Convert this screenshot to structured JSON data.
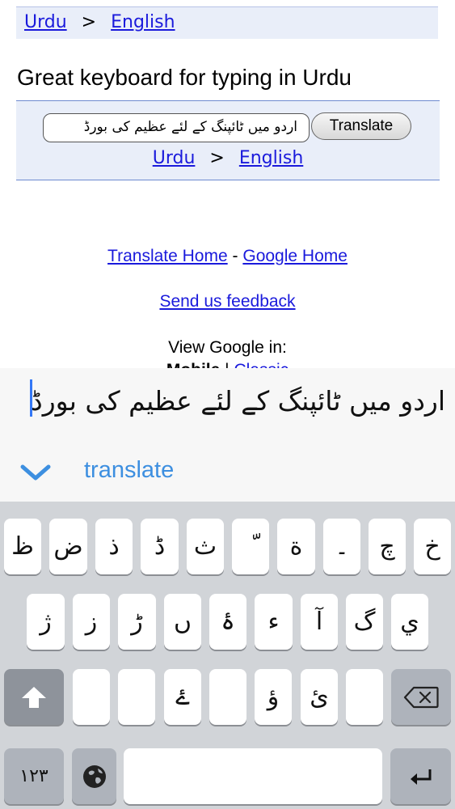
{
  "breadcrumb_top": {
    "from": "Urdu",
    "separator": ">",
    "to": "English"
  },
  "heading": "Great keyboard for typing in Urdu",
  "translate_box": {
    "input_value": "اردو میں ٹائپنگ کے لئے عظیم کی بورڈ",
    "button_label": "Translate",
    "from": "Urdu",
    "separator": ">",
    "to": "English"
  },
  "footer": {
    "translate_home": "Translate Home",
    "dash": "-",
    "google_home": "Google Home",
    "feedback": "Send us feedback",
    "view_in": "View Google in:",
    "mobile": "Mobile",
    "pipe": "|",
    "classic": "Classic"
  },
  "input_panel": {
    "preview_text": "اردو میں ٹائپنگ کے لئے عظیم کی بورڈ",
    "suggestion": "translate",
    "chevron_icon": "chevron-down-icon",
    "accent": "#3d8fe0"
  },
  "keyboard": {
    "row1": [
      "خ",
      "چ",
      "۔",
      "ة",
      "ّ",
      "ث",
      "ڈ",
      "ذ",
      "ض",
      "ظ"
    ],
    "row2": [
      "ي",
      "گ",
      "آ",
      "ء",
      "ۂ",
      "ں",
      "ڑ",
      "ز",
      "ژ"
    ],
    "row3": [
      "ئ",
      "ؤ",
      "ۓ"
    ],
    "numbers_key": "١٢٣",
    "icons": {
      "shift": "shift-icon",
      "backspace": "backspace-icon",
      "globe": "globe-icon",
      "return": "return-icon"
    }
  }
}
